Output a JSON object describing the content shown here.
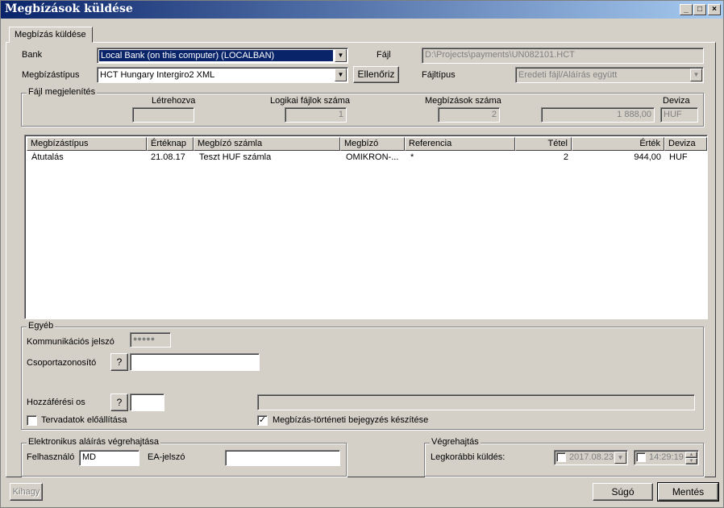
{
  "window": {
    "title": "Megbízások küldése",
    "min": "_",
    "max": "□",
    "close": "×"
  },
  "tab": {
    "label": "Megbízás küldése"
  },
  "form": {
    "bank_label": "Bank",
    "bank_value": "Local Bank (on this computer) (LOCALBAN)",
    "type_label": "Megbízástípus",
    "type_value": "HCT Hungary Intergiro2 XML",
    "check_button": "Ellenőriz",
    "file_label": "Fájl",
    "file_value": "D:\\Projects\\payments\\UN082101.HCT",
    "filetype_label": "Fájltípus",
    "filetype_value": "Eredeti fájl/Aláírás együtt"
  },
  "file_display": {
    "caption": "Fájl megjelenítés",
    "created_label": "Létrehozva",
    "created_value": "",
    "logical_label": "Logikai fájlok száma",
    "logical_value": "1",
    "count_label": "Megbízások száma",
    "count_value": "2",
    "amount_value": "1 888,00",
    "currency_label": "Deviza",
    "currency_value": "HUF"
  },
  "table": {
    "columns": [
      "Megbízástípus",
      "Értéknap",
      "Megbízó számla",
      "Megbízó",
      "Referencia",
      "Tétel",
      "Érték",
      "Deviza"
    ],
    "rows": [
      [
        "Átutalás",
        "21.08.17",
        "Teszt HUF számla",
        "OMIKRON-...",
        "*",
        "2",
        "944,00",
        "HUF"
      ]
    ]
  },
  "other": {
    "caption": "Egyéb",
    "comm_pw_label": "Kommunikációs jelszó",
    "comm_pw_value": "●●●●●",
    "group_id_label": "Csoportazonosító",
    "group_id_help": "?",
    "access_label": "Hozzáférési os",
    "access_help": "?",
    "plan_label": "Tervadatok előállítása",
    "plan_checked": false,
    "history_label": "Megbízás-történeti bejegyzés készítése",
    "history_checked": true
  },
  "esign": {
    "caption": "Elektronikus aláírás végrehajtása",
    "user_label": "Felhasználó",
    "user_value": "MD",
    "pw_label": "EA-jelszó"
  },
  "exec": {
    "caption": "Végrehajtás",
    "earliest_label": "Legkorábbi küldés:",
    "date_value": "2017.08.23",
    "time_value": "14:29:19"
  },
  "buttons": {
    "skip": "Kihagy",
    "help": "Súgó",
    "save": "Mentés"
  },
  "colors": {
    "title_start": "#0a246a",
    "title_end": "#a6caf0",
    "selection": "#0a246a",
    "face": "#d4d0c8"
  }
}
